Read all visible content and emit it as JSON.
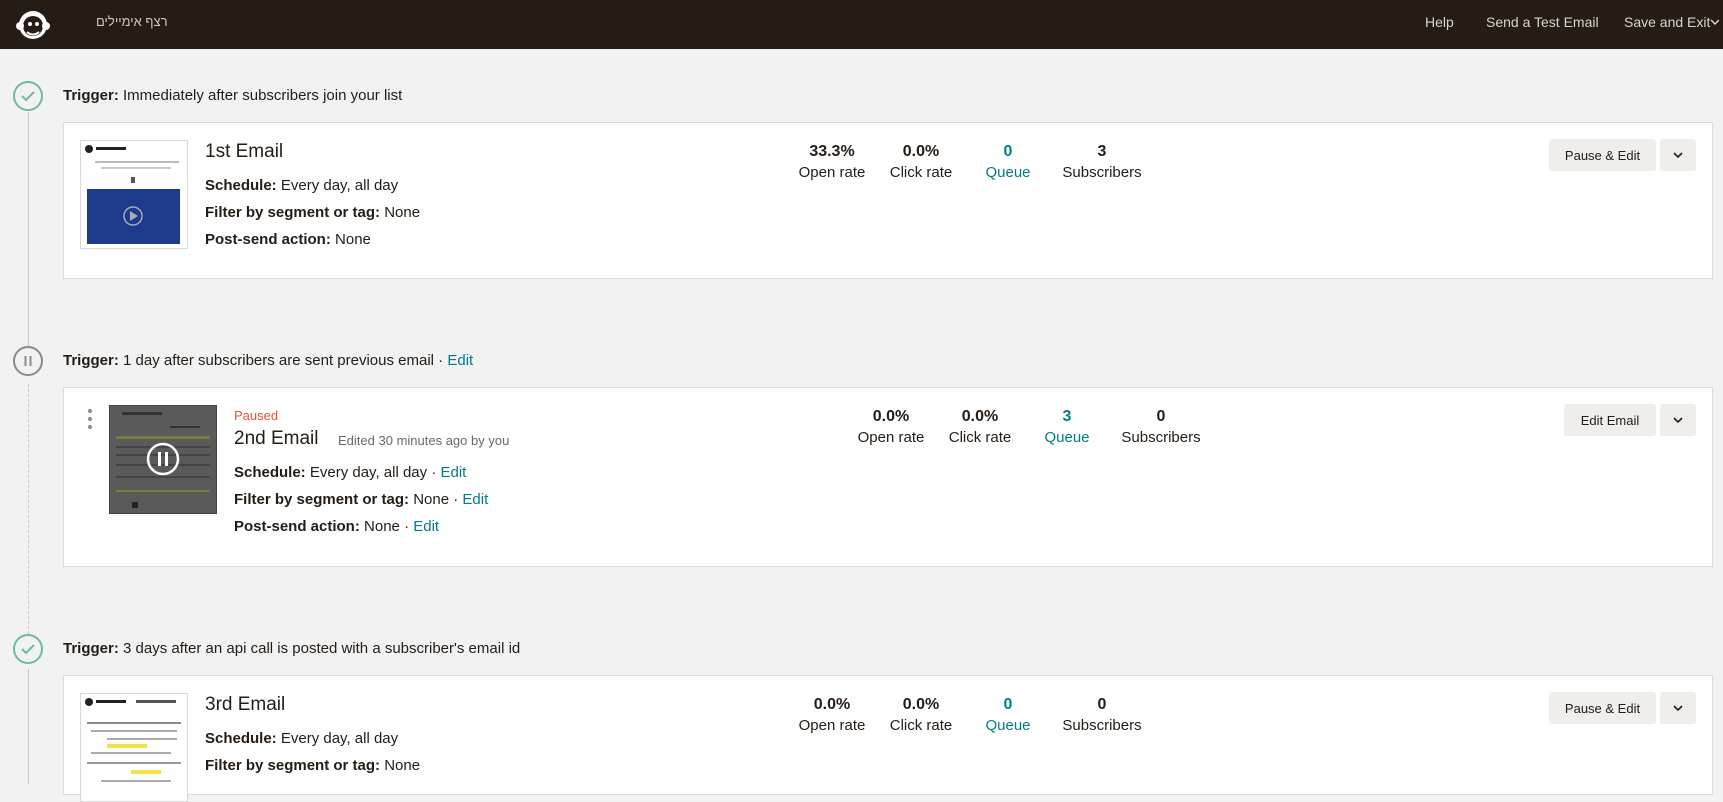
{
  "header": {
    "campaign_name": "רצף אימיילים",
    "help_label": "Help",
    "test_email_label": "Send a Test Email",
    "save_exit_label": "Save and Exit"
  },
  "steps": [
    {
      "trigger_label": "Trigger:",
      "trigger_text": "Immediately after subscribers join your list",
      "trigger_state": "active",
      "email": {
        "title": "1st Email",
        "schedule_label": "Schedule:",
        "schedule_value": "Every day, all day",
        "filter_label": "Filter by segment or tag:",
        "filter_value": "None",
        "post_label": "Post-send action:",
        "post_value": "None",
        "stats": [
          {
            "value": "33.3%",
            "label": "Open rate"
          },
          {
            "value": "0.0%",
            "label": "Click rate"
          },
          {
            "value": "0",
            "label": "Queue"
          },
          {
            "value": "3",
            "label": "Subscribers"
          }
        ],
        "action_label": "Pause & Edit"
      }
    },
    {
      "trigger_label": "Trigger:",
      "trigger_text": "1 day after subscribers are sent previous email",
      "trigger_edit": "Edit",
      "trigger_state": "paused",
      "email": {
        "status": "Paused",
        "title": "2nd Email",
        "edited_prefix": "Edited",
        "edited_time": "30 minutes ago",
        "edited_suffix": "by you",
        "schedule_label": "Schedule:",
        "schedule_value": "Every day, all day",
        "filter_label": "Filter by segment or tag:",
        "filter_value": "None",
        "post_label": "Post-send action:",
        "post_value": "None",
        "edit_label": "Edit",
        "separator": "·",
        "stats": [
          {
            "value": "0.0%",
            "label": "Open rate"
          },
          {
            "value": "0.0%",
            "label": "Click rate"
          },
          {
            "value": "3",
            "label": "Queue"
          },
          {
            "value": "0",
            "label": "Subscribers"
          }
        ],
        "action_label": "Edit Email"
      }
    },
    {
      "trigger_label": "Trigger:",
      "trigger_text": "3 days after an api call is posted with a subscriber's email id",
      "trigger_state": "active",
      "email": {
        "title": "3rd Email",
        "schedule_label": "Schedule:",
        "schedule_value": "Every day, all day",
        "filter_label": "Filter by segment or tag:",
        "filter_value": "None",
        "stats": [
          {
            "value": "0.0%",
            "label": "Open rate"
          },
          {
            "value": "0.0%",
            "label": "Click rate"
          },
          {
            "value": "0",
            "label": "Queue"
          },
          {
            "value": "0",
            "label": "Subscribers"
          }
        ],
        "action_label": "Pause & Edit"
      }
    }
  ],
  "icons": {
    "logo": "mailchimp-logo-icon",
    "trigger_active": "check-circle-icon",
    "trigger_paused": "pause-circle-icon",
    "caret": "chevron-down-icon",
    "drag": "drag-handle-icon"
  },
  "colors": {
    "topbar": "#241c15",
    "link": "#007c89",
    "paused": "#e0533e",
    "check": "#6fb8a5",
    "button": "#efeeea"
  }
}
